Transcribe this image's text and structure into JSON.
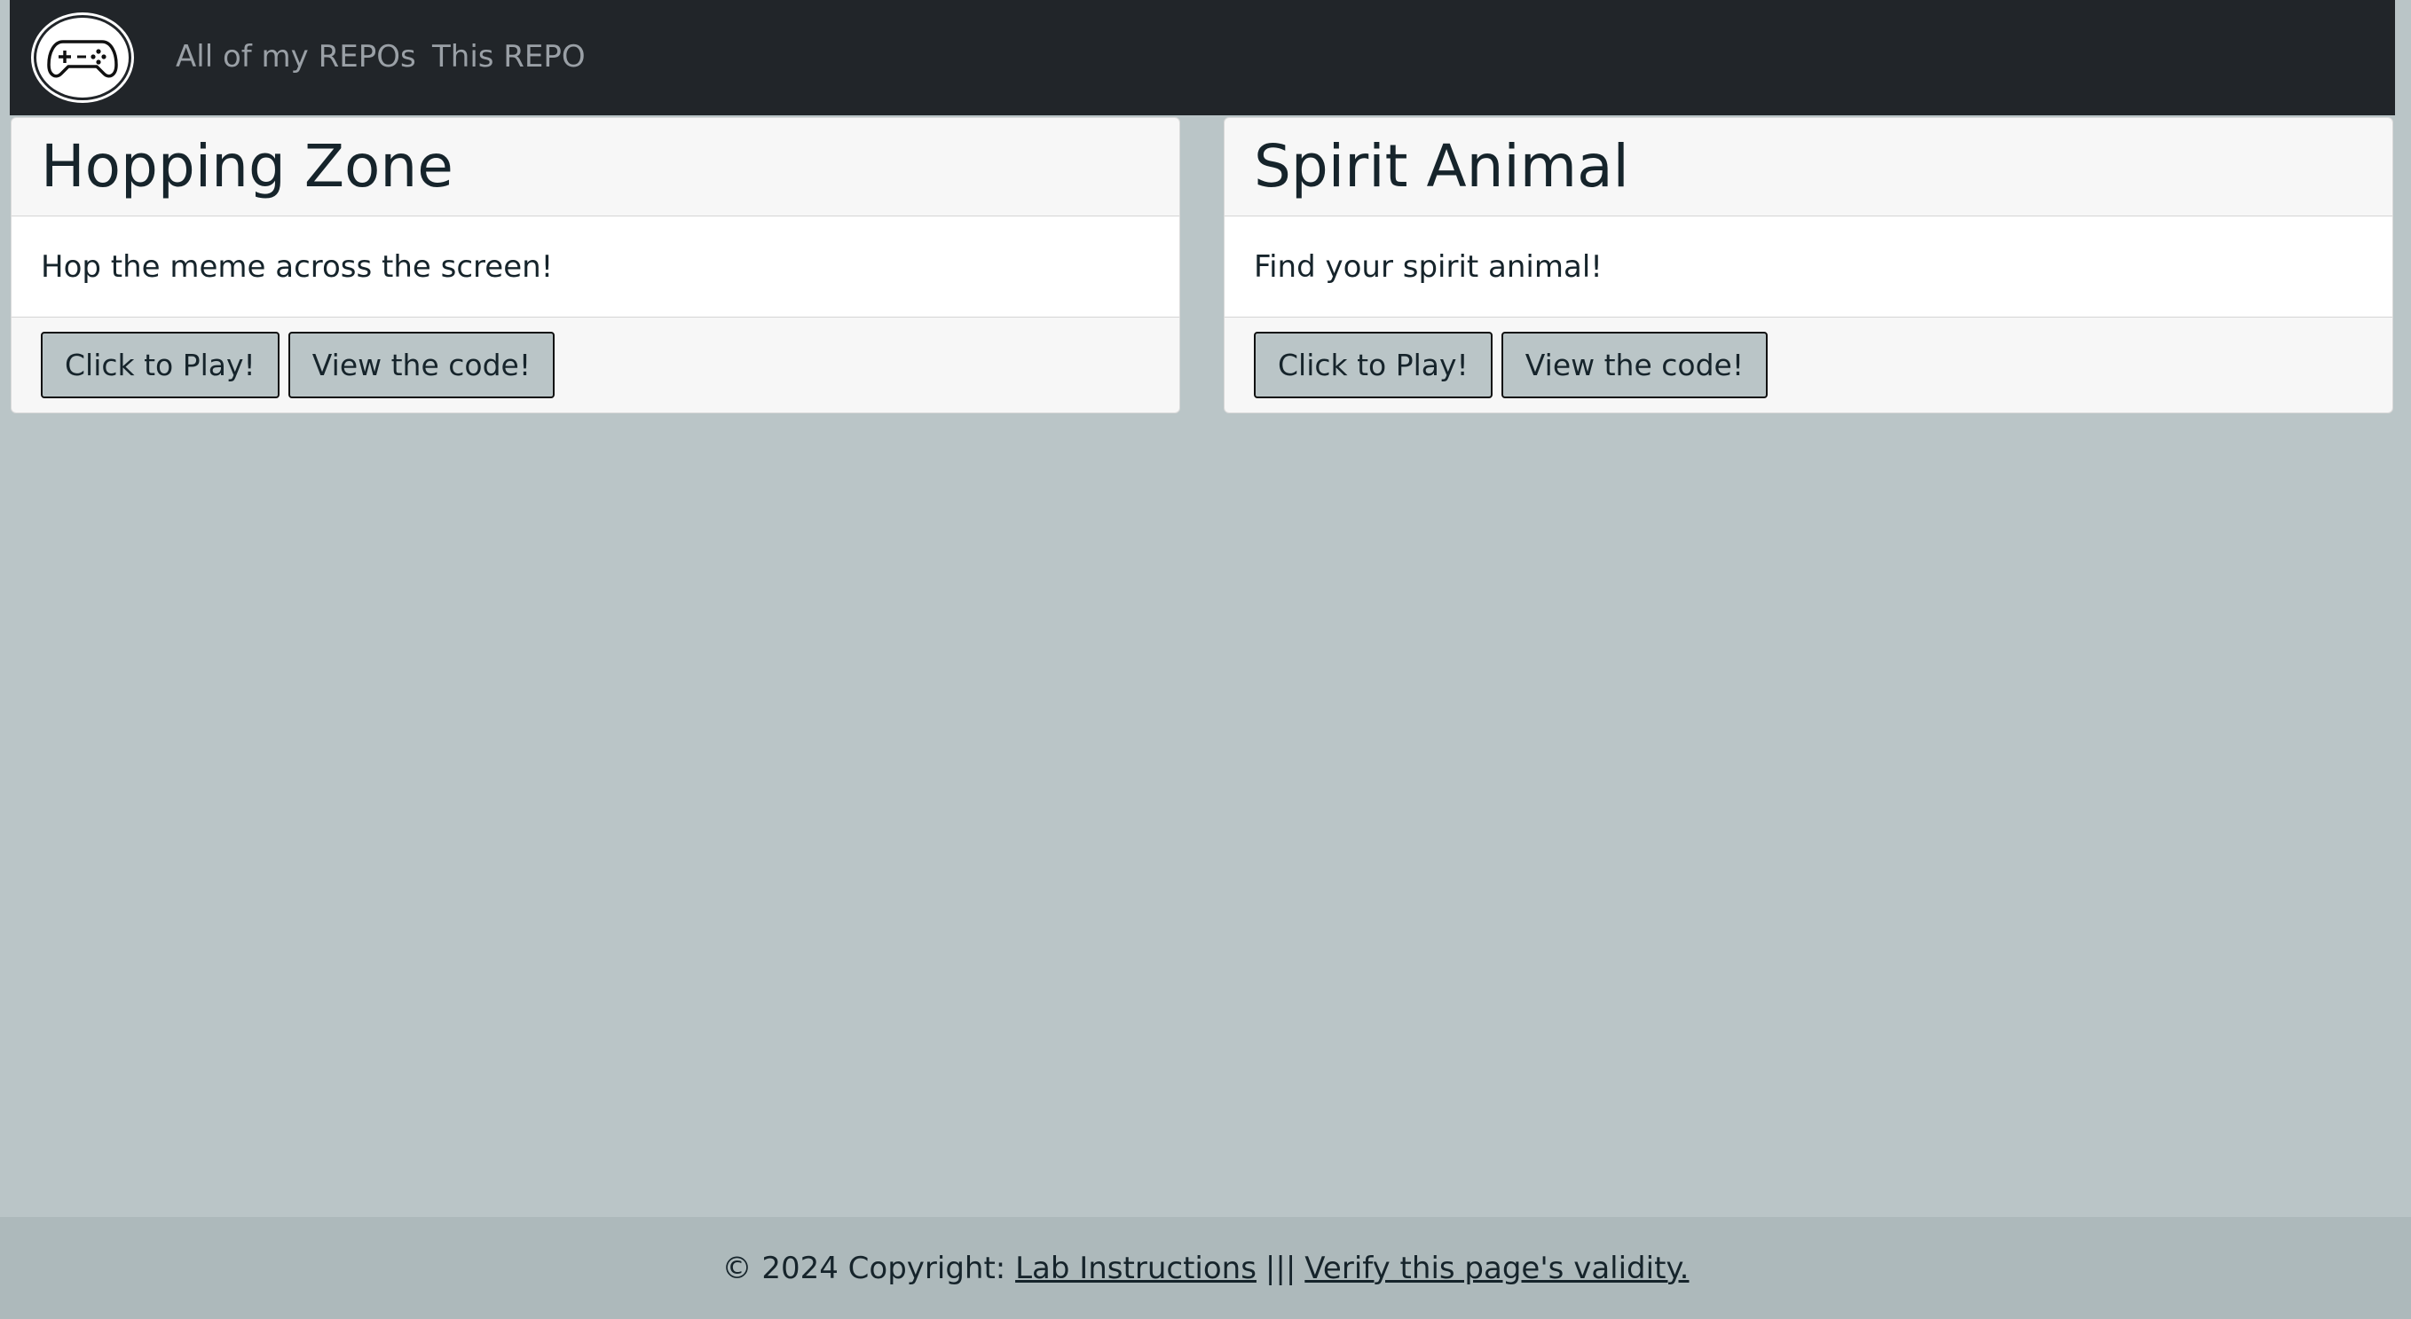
{
  "navbar": {
    "logo_icon": "gamepad-icon",
    "links": [
      {
        "label": "All of my REPOs"
      },
      {
        "label": "This REPO"
      }
    ]
  },
  "cards": [
    {
      "title": "Hopping Zone",
      "description": "Hop the meme across the screen!",
      "play_label": "Click to Play!",
      "code_label": "View the code!"
    },
    {
      "title": "Spirit Animal",
      "description": "Find your spirit animal!",
      "play_label": "Click to Play!",
      "code_label": "View the code!"
    }
  ],
  "footer": {
    "copyright": "© 2024 Copyright:",
    "lab_link": "Lab Instructions",
    "separator": "|||",
    "verify_link": "Verify this page's validity."
  },
  "colors": {
    "page_background": "#bac5c7",
    "navbar_background": "#212529",
    "footer_background": "#adb9bb",
    "text": "#16242b"
  }
}
